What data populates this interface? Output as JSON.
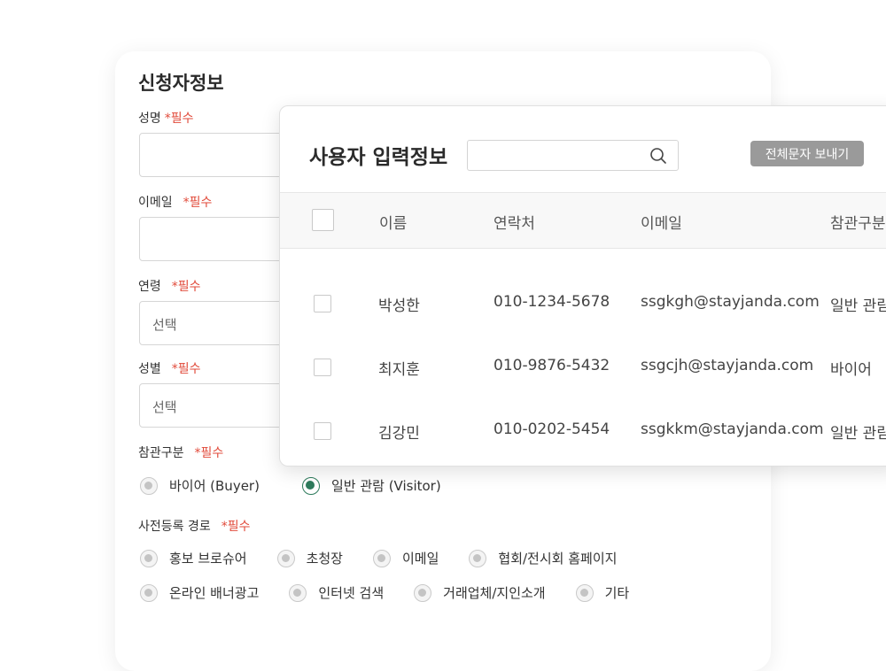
{
  "form": {
    "title": "신청자정보",
    "required_mark": "*필수",
    "fields": [
      {
        "label": "성명"
      },
      {
        "label": "이메일"
      },
      {
        "label": "연령",
        "placeholder": "선택"
      },
      {
        "label": "성별",
        "placeholder": "선택"
      }
    ],
    "visit_type": {
      "label": "참관구분",
      "options": [
        {
          "label": "바이어 (Buyer)",
          "selected": false
        },
        {
          "label": "일반 관람 (Visitor)",
          "selected": true
        }
      ]
    },
    "route": {
      "label": "사전등록 경로",
      "options": [
        {
          "label": "홍보 브로슈어",
          "selected": false
        },
        {
          "label": "초청장",
          "selected": false
        },
        {
          "label": "이메일",
          "selected": false
        },
        {
          "label": "협회/전시회 홈페이지",
          "selected": false
        },
        {
          "label": "온라인 배너광고",
          "selected": true
        },
        {
          "label": "인터넷 검색",
          "selected": false
        },
        {
          "label": "거래업체/지인소개",
          "selected": false
        },
        {
          "label": "기타",
          "selected": false
        }
      ]
    }
  },
  "panel": {
    "title": "사용자 입력정보",
    "search_value": "",
    "send_all_sms_label": "전체문자 보내기",
    "columns": [
      "이름",
      "연락처",
      "이메일",
      "참관구분"
    ],
    "rows": [
      {
        "name": "박성한",
        "phone": "010-1234-5678",
        "email": "ssgkgh@stayjanda.com",
        "type": "일반 관람"
      },
      {
        "name": "최지훈",
        "phone": "010-9876-5432",
        "email": "ssgcjh@stayjanda.com",
        "type": "바이어"
      },
      {
        "name": "김강민",
        "phone": "010-0202-5454",
        "email": "ssgkkm@stayjanda.com",
        "type": "일반 관람"
      }
    ]
  },
  "colors": {
    "accent": "#2e7b5c",
    "required": "#e14a3a",
    "button": "#9a9a9a"
  }
}
